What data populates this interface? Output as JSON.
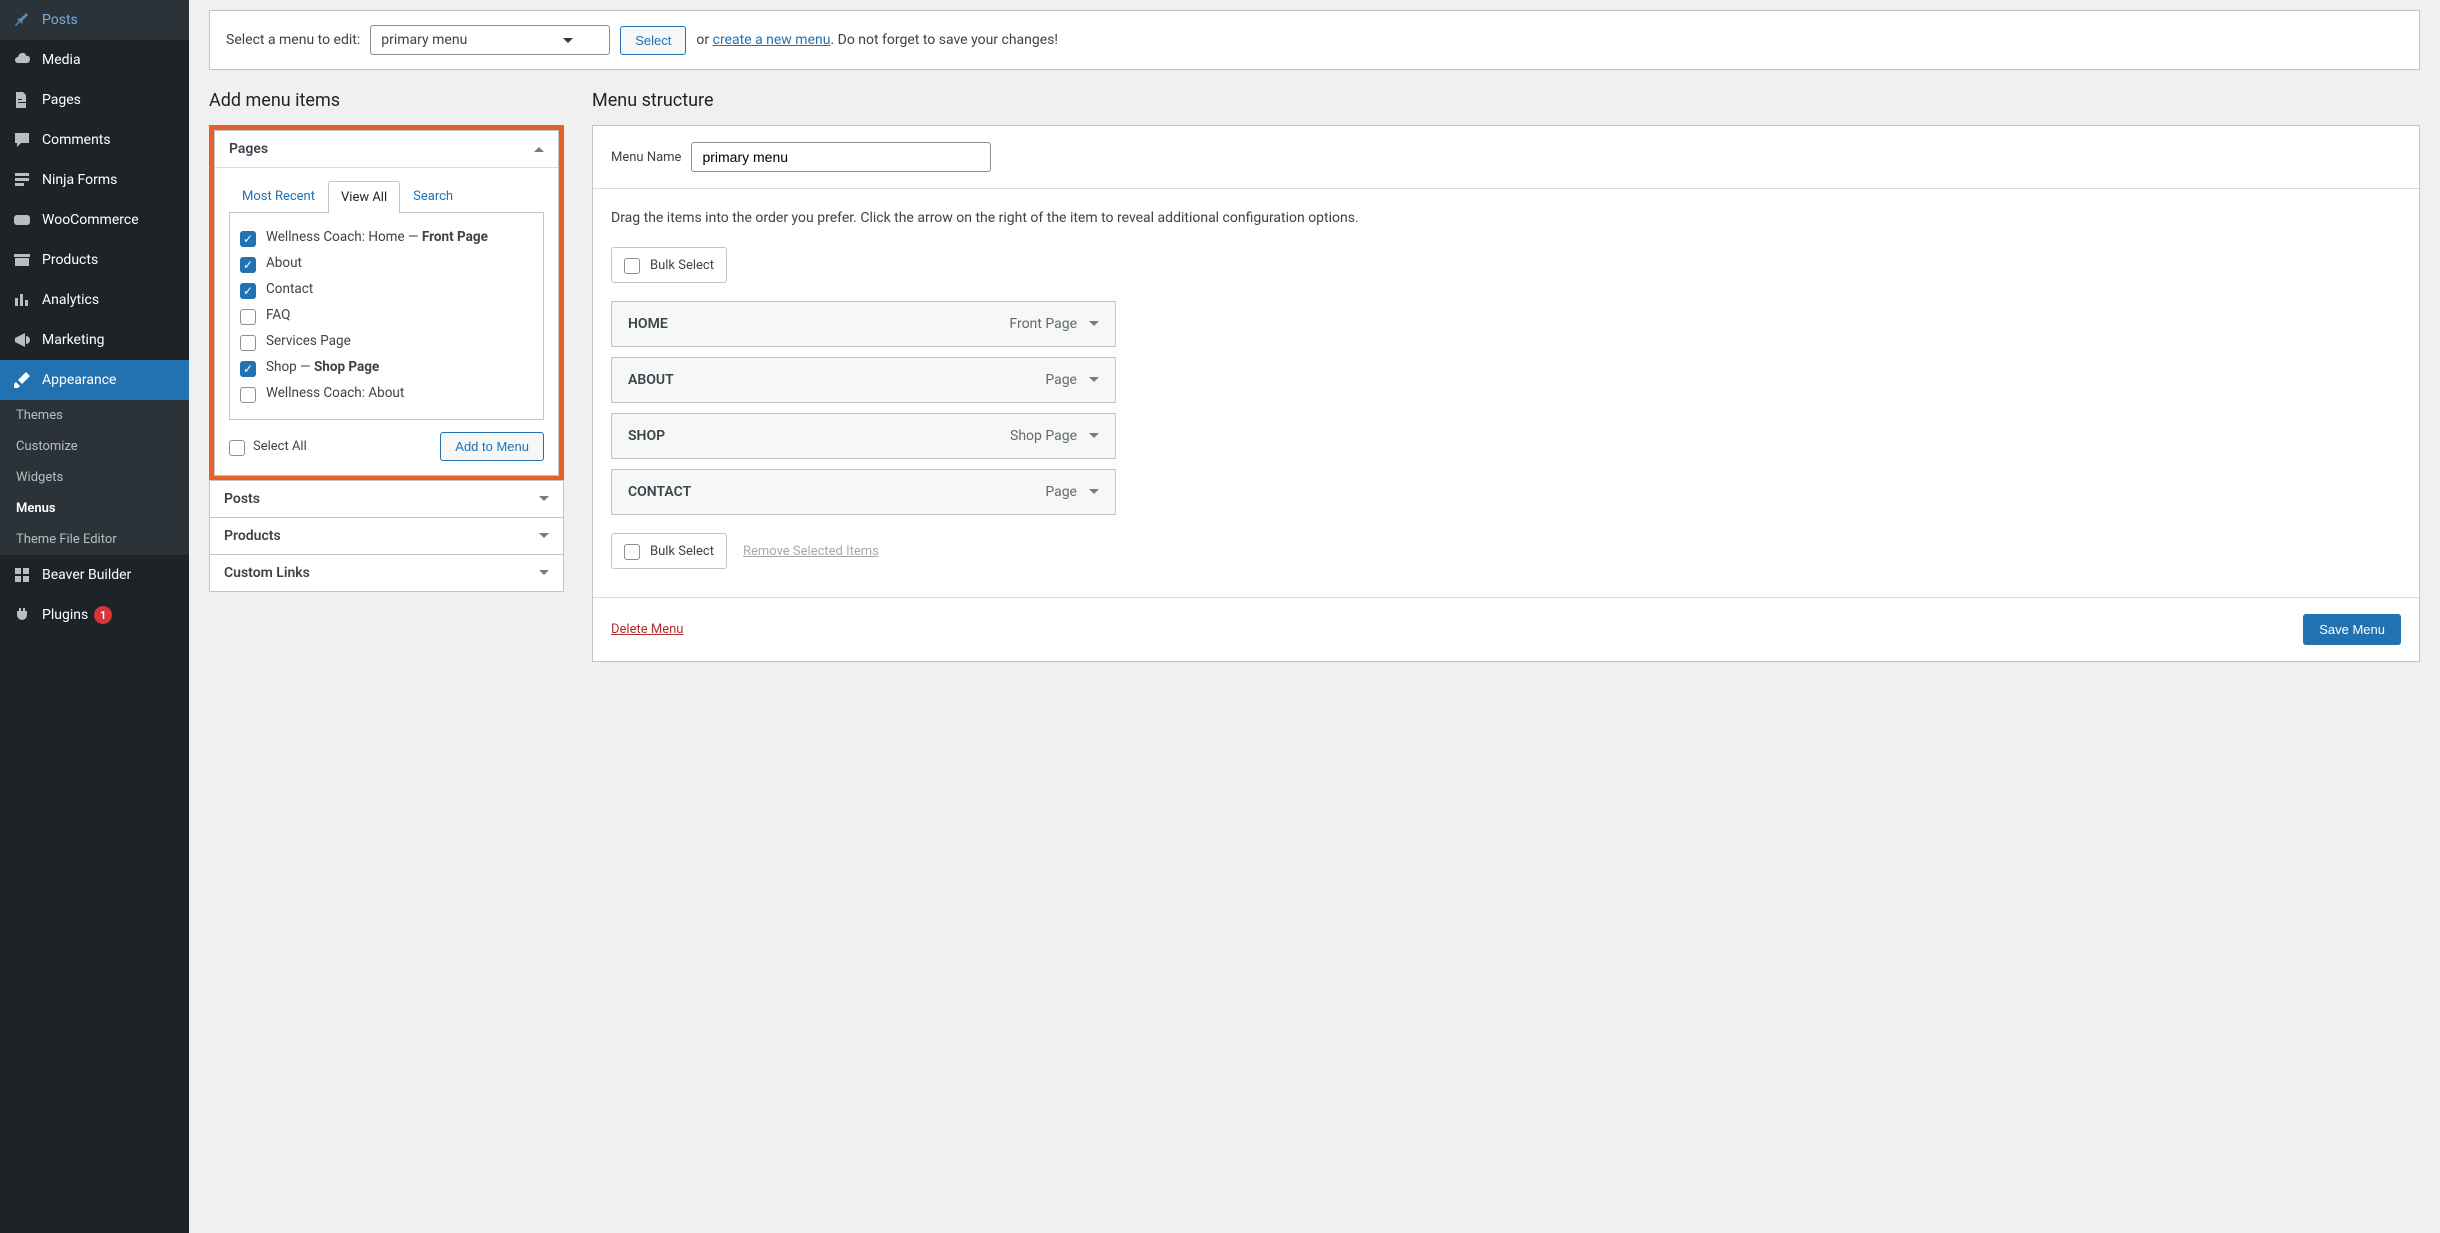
{
  "sidebar": {
    "items": [
      {
        "label": "Posts"
      },
      {
        "label": "Media"
      },
      {
        "label": "Pages"
      },
      {
        "label": "Comments"
      },
      {
        "label": "Ninja Forms"
      },
      {
        "label": "WooCommerce"
      },
      {
        "label": "Products"
      },
      {
        "label": "Analytics"
      },
      {
        "label": "Marketing"
      },
      {
        "label": "Appearance"
      },
      {
        "label": "Beaver Builder"
      },
      {
        "label": "Plugins"
      }
    ],
    "sub_items": [
      {
        "label": "Themes"
      },
      {
        "label": "Customize"
      },
      {
        "label": "Widgets"
      },
      {
        "label": "Menus"
      },
      {
        "label": "Theme File Editor"
      }
    ],
    "plugins_badge": "1"
  },
  "toolbar": {
    "select_menu_label": "Select a menu to edit:",
    "current_menu": "primary menu",
    "select_button": "Select",
    "or_text": "or ",
    "create_new_link": "create a new menu",
    "save_hint": ". Do not forget to save your changes!"
  },
  "left_col": {
    "title": "Add menu items",
    "accordions": {
      "pages": "Pages",
      "posts": "Posts",
      "products": "Products",
      "custom_links": "Custom Links"
    },
    "tabs": {
      "most_recent": "Most Recent",
      "view_all": "View All",
      "search": "Search"
    },
    "page_list": [
      {
        "checked": true,
        "label": "Wellness Coach: Home — ",
        "suffix": "Front Page"
      },
      {
        "checked": true,
        "label": "About"
      },
      {
        "checked": true,
        "label": "Contact"
      },
      {
        "checked": false,
        "label": "FAQ"
      },
      {
        "checked": false,
        "label": "Services Page"
      },
      {
        "checked": true,
        "label": "Shop — ",
        "suffix": "Shop Page"
      },
      {
        "checked": false,
        "label": "Wellness Coach: About"
      }
    ],
    "select_all": "Select All",
    "add_to_menu": "Add to Menu"
  },
  "right_col": {
    "title": "Menu structure",
    "menu_name_label": "Menu Name",
    "menu_name_value": "primary menu",
    "help_text": "Drag the items into the order you prefer. Click the arrow on the right of the item to reveal additional configuration options.",
    "bulk_select": "Bulk Select",
    "remove_selected": "Remove Selected Items",
    "menu_items": [
      {
        "title": "HOME",
        "type": "Front Page"
      },
      {
        "title": "ABOUT",
        "type": "Page"
      },
      {
        "title": "SHOP",
        "type": "Shop Page"
      },
      {
        "title": "CONTACT",
        "type": "Page"
      }
    ],
    "delete_menu": "Delete Menu",
    "save_menu": "Save Menu"
  }
}
